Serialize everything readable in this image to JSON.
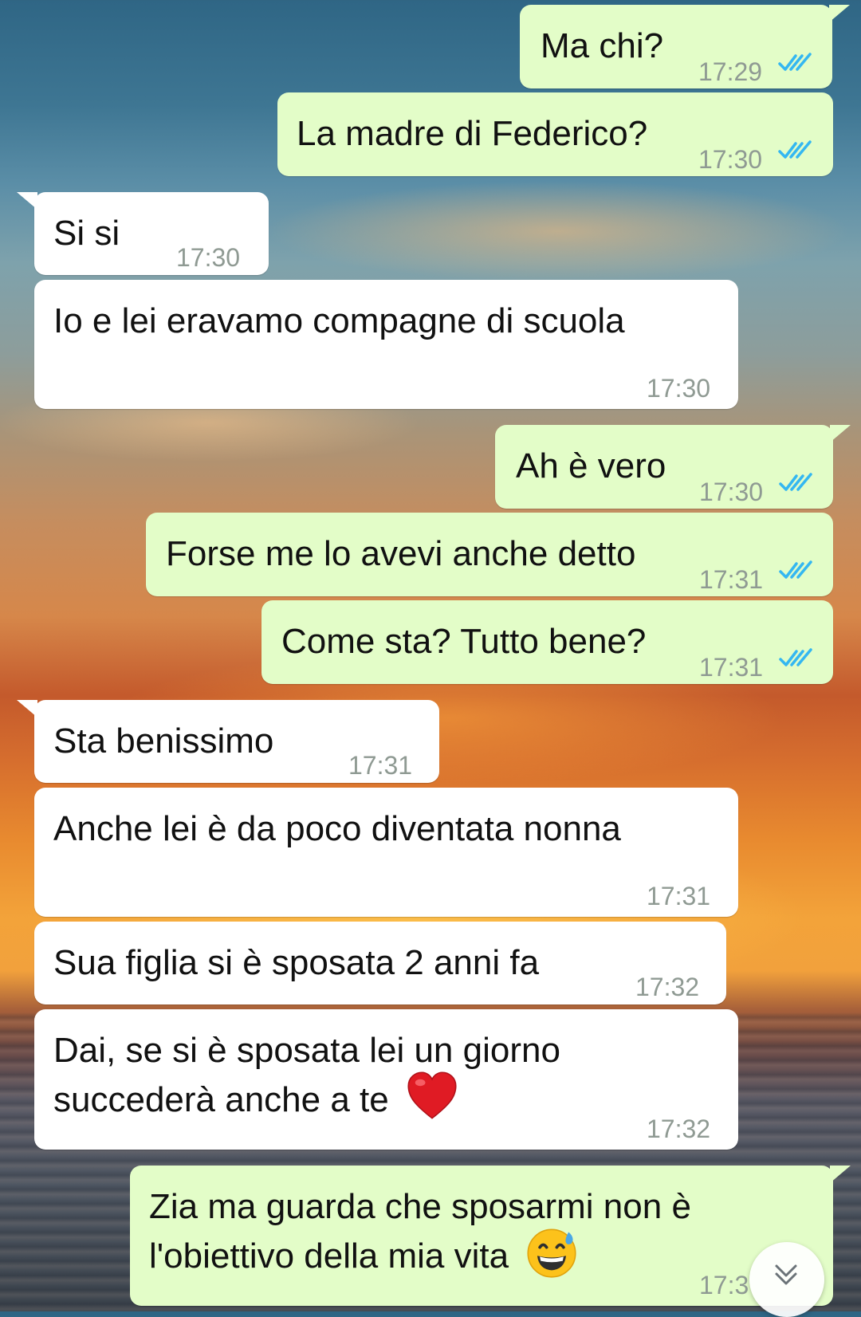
{
  "messages": [
    {
      "text": "Ma chi?",
      "time": "17:29",
      "direction": "out",
      "status": "read"
    },
    {
      "text": "La madre di Federico?",
      "time": "17:30",
      "direction": "out",
      "status": "read"
    },
    {
      "text": "Si si",
      "time": "17:30",
      "direction": "in"
    },
    {
      "text": "Io e lei eravamo compagne di scuola",
      "time": "17:30",
      "direction": "in"
    },
    {
      "text": "Ah è vero",
      "time": "17:30",
      "direction": "out",
      "status": "read"
    },
    {
      "text": "Forse me lo avevi anche detto",
      "time": "17:31",
      "direction": "out",
      "status": "read"
    },
    {
      "text": "Come sta? Tutto bene?",
      "time": "17:31",
      "direction": "out",
      "status": "read"
    },
    {
      "text": "Sta benissimo",
      "time": "17:31",
      "direction": "in"
    },
    {
      "text": "Anche lei è da poco diventata nonna",
      "time": "17:31",
      "direction": "in"
    },
    {
      "text": "Sua figlia si è sposata 2 anni fa",
      "time": "17:32",
      "direction": "in"
    },
    {
      "line1": "Dai, se si è sposata lei un giorno",
      "line2": "succederà anche a te",
      "emoji": "red-heart",
      "time": "17:32",
      "direction": "in"
    },
    {
      "line1": "Zia ma guarda che sposarmi non è",
      "line2": "l'obiettivo della mia vita",
      "emoji": "grinning-face-with-sweat",
      "time": "17:3",
      "direction": "out"
    }
  ],
  "colors": {
    "outgoing_bubble": "#e3fdc8",
    "incoming_bubble": "#ffffff",
    "read_ticks": "#34b7f1",
    "timestamp": "#8f9a93"
  },
  "icons": {
    "read_receipt": "double-check-icon",
    "scroll_down": "chevron-double-down-icon"
  }
}
